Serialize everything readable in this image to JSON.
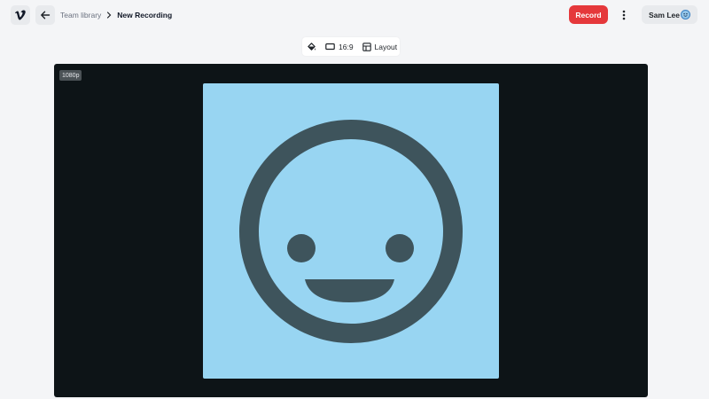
{
  "header": {
    "logo_icon": "vimeo-v-icon",
    "back_icon": "arrow-left-icon",
    "breadcrumb": {
      "parent": "Team library",
      "current": "New Recording"
    },
    "record_label": "Record",
    "more_icon": "vertical-dots-icon",
    "user_name": "Sam Lee",
    "avatar_icon": "smiley-avatar-icon"
  },
  "toolbar": {
    "background_icon": "paint-bucket-icon",
    "aspect_label": "16:9",
    "aspect_icon": "rectangle-icon",
    "layout_label": "Layout",
    "layout_icon": "layout-grid-icon"
  },
  "canvas": {
    "resolution_badge": "1080p",
    "preview_icon": "smiley-face-icon"
  },
  "colors": {
    "record": "#e5383b",
    "canvas_bg": "#0d1417",
    "preview_bg": "#98d5f2",
    "smiley": "#3e545c"
  }
}
